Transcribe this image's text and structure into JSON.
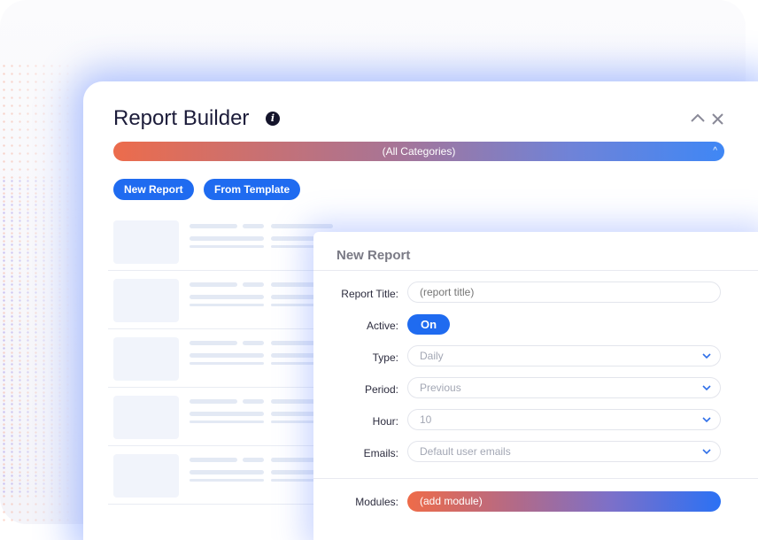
{
  "app": {
    "title": "Report Builder",
    "info_icon": "info-icon",
    "controls": {
      "collapse": "^",
      "close": "×"
    }
  },
  "category_bar": {
    "label": "(All Categories)",
    "chevron": "^"
  },
  "actions": {
    "new_report": "New Report",
    "from_template": "From Template"
  },
  "colors": {
    "accent": "#1f6bf0",
    "gradient_start": "#ec6c4c",
    "gradient_end": "#3f87f5",
    "title": "#1c1c3a"
  },
  "form": {
    "title": "New Report",
    "fields": {
      "report_title": {
        "label": "Report Title:",
        "placeholder": "(report title)"
      },
      "active": {
        "label": "Active:",
        "value": "On"
      },
      "type": {
        "label": "Type:",
        "value": "Daily"
      },
      "period": {
        "label": "Period:",
        "value": "Previous"
      },
      "hour": {
        "label": "Hour:",
        "value": "10"
      },
      "emails": {
        "label": "Emails:",
        "value": "Default user emails"
      },
      "modules": {
        "label": "Modules:",
        "value": "(add module)"
      }
    },
    "chevron_icon": "chevron-down-icon"
  }
}
